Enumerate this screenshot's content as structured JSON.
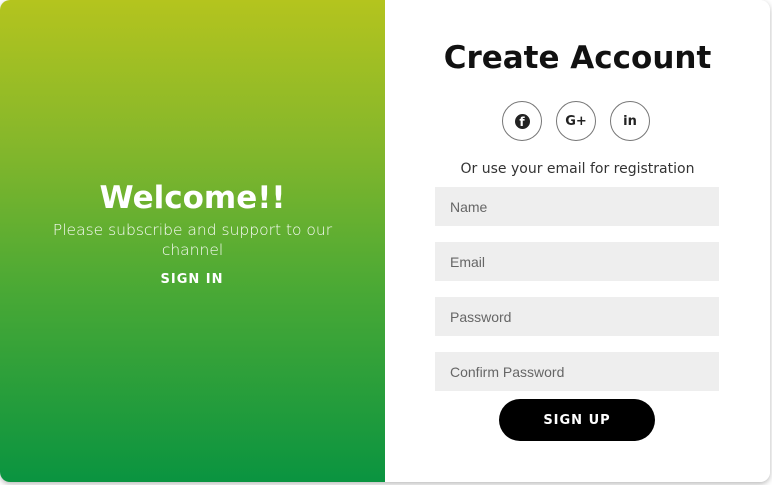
{
  "welcome": {
    "title": "Welcome!!",
    "text": "Please subscribe and support to our channel",
    "signin_label": "SIGN IN"
  },
  "signup": {
    "title": "Create Account",
    "social": {
      "facebook_glyph": "f",
      "google_glyph": "G+",
      "linkedin_glyph": "in"
    },
    "subtitle": "Or use your email for registration",
    "fields": {
      "name_placeholder": "Name",
      "email_placeholder": "Email",
      "password_placeholder": "Password",
      "confirm_placeholder": "Confirm Password"
    },
    "submit_label": "SIGN UP"
  },
  "colors": {
    "gradient_top": "#b4c41e",
    "gradient_bottom": "#0a9440",
    "button": "#000000",
    "input_bg": "#eeeeee"
  },
  "icons": [
    "facebook-icon",
    "google-plus-icon",
    "linkedin-icon"
  ]
}
